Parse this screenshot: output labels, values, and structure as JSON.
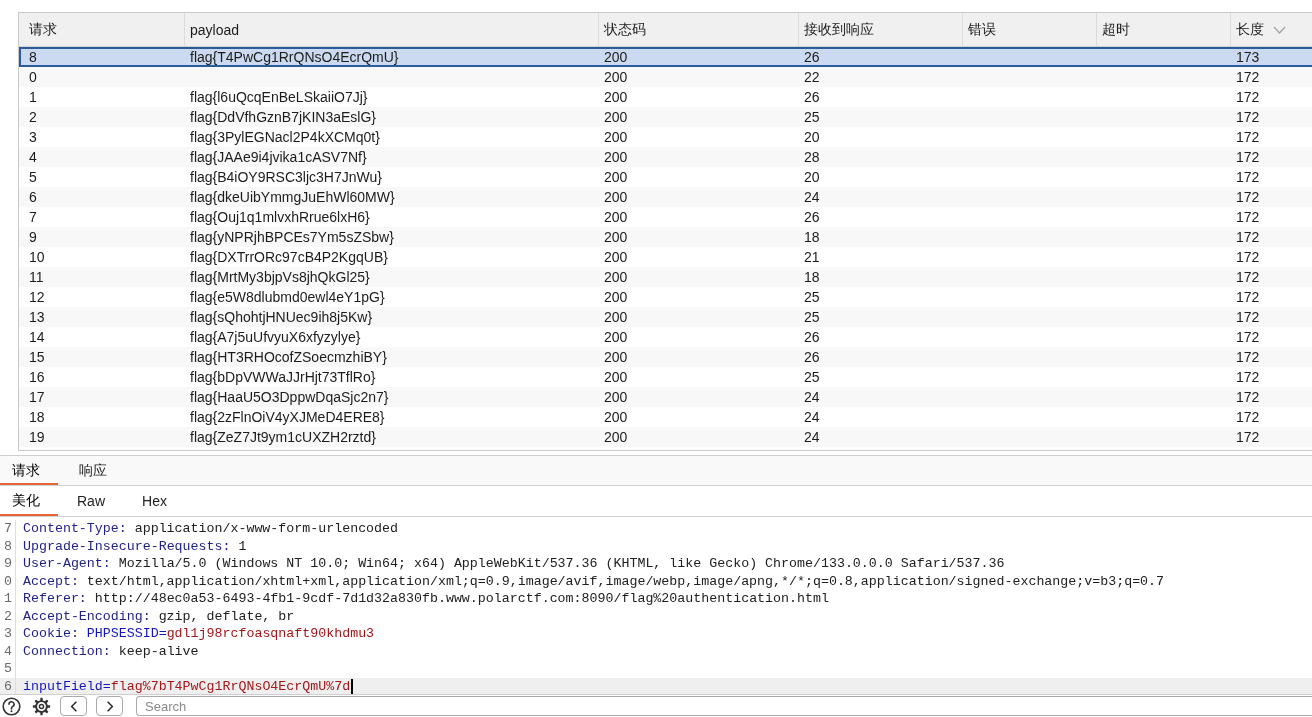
{
  "table": {
    "columns": [
      {
        "label": "请求"
      },
      {
        "label": "payload"
      },
      {
        "label": "状态码"
      },
      {
        "label": "接收到响应"
      },
      {
        "label": "错误"
      },
      {
        "label": "超时"
      },
      {
        "label": "长度",
        "sorted_descending": true
      }
    ],
    "rows": [
      {
        "request": "8",
        "payload": "flag{T4PwCg1RrQNsO4EcrQmU}",
        "status": "200",
        "received": "26",
        "length": "173",
        "selected": true
      },
      {
        "request": "0",
        "status": "200",
        "received": "22",
        "length": "172",
        "selected": false
      },
      {
        "request": "1",
        "payload": "flag{l6uQcqEnBeLSkaiiO7Jj}",
        "status": "200",
        "received": "26",
        "length": "172",
        "selected": false
      },
      {
        "request": "2",
        "payload": "flag{DdVfhGznB7jKIN3aEslG}",
        "status": "200",
        "received": "25",
        "length": "172",
        "selected": false
      },
      {
        "request": "3",
        "payload": "flag{3PylEGNacl2P4kXCMq0t}",
        "status": "200",
        "received": "20",
        "length": "172",
        "selected": false
      },
      {
        "request": "4",
        "payload": "flag{JAAe9i4jvika1cASV7Nf}",
        "status": "200",
        "received": "28",
        "length": "172",
        "selected": false
      },
      {
        "request": "5",
        "payload": "flag{B4iOY9RSC3ljc3H7JnWu}",
        "status": "200",
        "received": "20",
        "length": "172",
        "selected": false
      },
      {
        "request": "6",
        "payload": "flag{dkeUibYmmgJuEhWl60MW}",
        "status": "200",
        "received": "24",
        "length": "172",
        "selected": false
      },
      {
        "request": "7",
        "payload": "flag{Ouj1q1mlvxhRrue6lxH6}",
        "status": "200",
        "received": "26",
        "length": "172",
        "selected": false
      },
      {
        "request": "9",
        "payload": "flag{yNPRjhBPCEs7Ym5sZSbw}",
        "status": "200",
        "received": "18",
        "length": "172",
        "selected": false
      },
      {
        "request": "10",
        "payload": "flag{DXTrrORc97cB4P2KgqUB}",
        "status": "200",
        "received": "21",
        "length": "172",
        "selected": false
      },
      {
        "request": "11",
        "payload": "flag{MrtMy3bjpVs8jhQkGl25}",
        "status": "200",
        "received": "18",
        "length": "172",
        "selected": false
      },
      {
        "request": "12",
        "payload": "flag{e5W8dlubmd0ewl4eY1pG}",
        "status": "200",
        "received": "25",
        "length": "172",
        "selected": false
      },
      {
        "request": "13",
        "payload": "flag{sQhohtjHNUec9ih8j5Kw}",
        "status": "200",
        "received": "25",
        "length": "172",
        "selected": false
      },
      {
        "request": "14",
        "payload": "flag{A7j5uUfvyuX6xfyzylye}",
        "status": "200",
        "received": "26",
        "length": "172",
        "selected": false
      },
      {
        "request": "15",
        "payload": "flag{HT3RHOcofZSoecmzhiBY}",
        "status": "200",
        "received": "26",
        "length": "172",
        "selected": false
      },
      {
        "request": "16",
        "payload": "flag{bDpVWWaJJrHjt73TflRo}",
        "status": "200",
        "received": "25",
        "length": "172",
        "selected": false
      },
      {
        "request": "17",
        "payload": "flag{HaaU5O3DppwDqaSjc2n7}",
        "status": "200",
        "received": "24",
        "length": "172",
        "selected": false
      },
      {
        "request": "18",
        "payload": "flag{2zFlnOiV4yXJMeD4ERE8}",
        "status": "200",
        "received": "24",
        "length": "172",
        "selected": false
      },
      {
        "request": "19",
        "payload": "flag{ZeZ7Jt9ym1cUXZH2rztd}",
        "status": "200",
        "received": "24",
        "length": "172",
        "selected": false
      }
    ]
  },
  "message_tabs": [
    {
      "label": "请求",
      "selected": true
    },
    {
      "label": "响应",
      "selected": false
    }
  ],
  "view_tabs": [
    {
      "label": "美化",
      "selected": true
    },
    {
      "label": "Raw",
      "selected": false
    },
    {
      "label": "Hex",
      "selected": false
    }
  ],
  "editor": {
    "lines": [
      {
        "number": "7",
        "kind": "header",
        "name": "Content-Type:",
        "value": "application/x-www-form-urlencoded",
        "current": false
      },
      {
        "number": "8",
        "kind": "header",
        "name": "Upgrade-Insecure-Requests:",
        "value": "1",
        "current": false
      },
      {
        "number": "9",
        "kind": "header",
        "name": "User-Agent:",
        "value": "Mozilla/5.0 (Windows NT 10.0; Win64; x64) AppleWebKit/537.36 (KHTML, like Gecko) Chrome/133.0.0.0 Safari/537.36",
        "current": false
      },
      {
        "number": "0",
        "kind": "header",
        "name": "Accept:",
        "value": "text/html,application/xhtml+xml,application/xml;q=0.9,image/avif,image/webp,image/apng,*/*;q=0.8,application/signed-exchange;v=b3;q=0.7",
        "current": false
      },
      {
        "number": "1",
        "kind": "header",
        "name": "Referer:",
        "value": "http://48ec0a53-6493-4fb1-9cdf-7d1d32a830fb.www.polarctf.com:8090/flag%20authentication.html",
        "current": false
      },
      {
        "number": "2",
        "kind": "header",
        "name": "Accept-Encoding:",
        "value": "gzip, deflate, br",
        "current": false
      },
      {
        "number": "3",
        "kind": "cookie",
        "name": "Cookie:",
        "cookie_name": "PHPSESSID=",
        "cookie_value": "gdl1j98rcfoasqnaft90khdmu3",
        "current": false
      },
      {
        "number": "4",
        "kind": "header",
        "name": "Connection:",
        "value": "keep-alive",
        "current": false
      },
      {
        "number": "5",
        "kind": "blank",
        "current": false
      },
      {
        "number": "6",
        "kind": "param",
        "name": "inputField=",
        "value": "flag%7bT4PwCg1RrQNsO4EcrQmU%7d",
        "current": true
      }
    ]
  },
  "search_field": {
    "placeholder": "Search"
  }
}
